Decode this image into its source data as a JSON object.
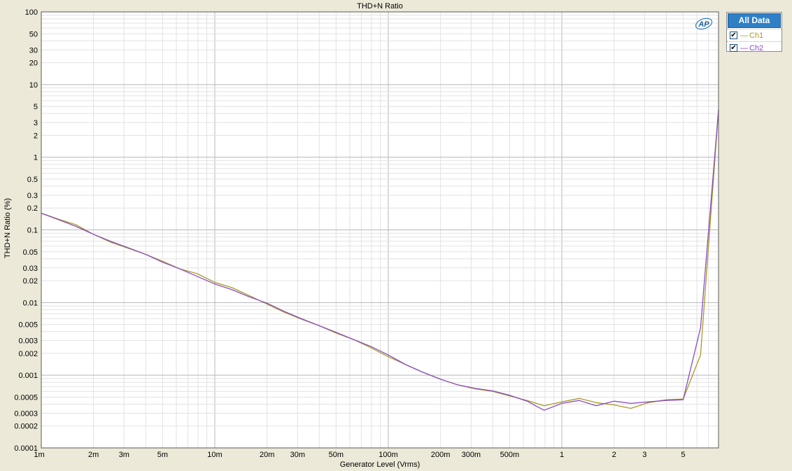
{
  "logo_text": "AP",
  "legend": {
    "header": "All Data",
    "items": [
      {
        "label": "Ch1",
        "color": "#a89a26",
        "checked": true
      },
      {
        "label": "Ch2",
        "color": "#8a4fc2",
        "checked": true
      }
    ]
  },
  "chart_data": {
    "type": "line",
    "title": "THD+N Ratio",
    "xlabel": "Generator Level (Vrms)",
    "ylabel": "THD+N Ratio (%)",
    "x_scale": "log",
    "y_scale": "log",
    "xlim": [
      0.001,
      8
    ],
    "ylim": [
      0.0001,
      100
    ],
    "grid": true,
    "legend_position": "right",
    "x_ticks": [
      {
        "value": 0.001,
        "label": "1m"
      },
      {
        "value": 0.002,
        "label": "2m"
      },
      {
        "value": 0.003,
        "label": "3m"
      },
      {
        "value": 0.005,
        "label": "5m"
      },
      {
        "value": 0.01,
        "label": "10m"
      },
      {
        "value": 0.02,
        "label": "20m"
      },
      {
        "value": 0.03,
        "label": "30m"
      },
      {
        "value": 0.05,
        "label": "50m"
      },
      {
        "value": 0.1,
        "label": "100m"
      },
      {
        "value": 0.2,
        "label": "200m"
      },
      {
        "value": 0.3,
        "label": "300m"
      },
      {
        "value": 0.5,
        "label": "500m"
      },
      {
        "value": 1,
        "label": "1"
      },
      {
        "value": 2,
        "label": "2"
      },
      {
        "value": 3,
        "label": "3"
      },
      {
        "value": 5,
        "label": "5"
      }
    ],
    "y_ticks": [
      {
        "value": 100,
        "label": "100"
      },
      {
        "value": 50,
        "label": "50"
      },
      {
        "value": 30,
        "label": "30"
      },
      {
        "value": 20,
        "label": "20"
      },
      {
        "value": 10,
        "label": "10"
      },
      {
        "value": 5,
        "label": "5"
      },
      {
        "value": 3,
        "label": "3"
      },
      {
        "value": 2,
        "label": "2"
      },
      {
        "value": 1,
        "label": "1"
      },
      {
        "value": 0.5,
        "label": "0.5"
      },
      {
        "value": 0.3,
        "label": "0.3"
      },
      {
        "value": 0.2,
        "label": "0.2"
      },
      {
        "value": 0.1,
        "label": "0.1"
      },
      {
        "value": 0.05,
        "label": "0.05"
      },
      {
        "value": 0.03,
        "label": "0.03"
      },
      {
        "value": 0.02,
        "label": "0.02"
      },
      {
        "value": 0.01,
        "label": "0.01"
      },
      {
        "value": 0.005,
        "label": "0.005"
      },
      {
        "value": 0.003,
        "label": "0.003"
      },
      {
        "value": 0.002,
        "label": "0.002"
      },
      {
        "value": 0.001,
        "label": "0.001"
      },
      {
        "value": 0.0005,
        "label": "0.0005"
      },
      {
        "value": 0.0003,
        "label": "0.0003"
      },
      {
        "value": 0.0002,
        "label": "0.0002"
      },
      {
        "value": 0.0001,
        "label": "0.0001"
      }
    ],
    "series": [
      {
        "name": "Ch1",
        "color": "#a89a26",
        "points": [
          [
            0.001,
            0.17
          ],
          [
            0.00126,
            0.14
          ],
          [
            0.00158,
            0.118
          ],
          [
            0.002,
            0.087
          ],
          [
            0.0025,
            0.068
          ],
          [
            0.00316,
            0.056
          ],
          [
            0.004,
            0.046
          ],
          [
            0.005,
            0.037
          ],
          [
            0.0063,
            0.029
          ],
          [
            0.0079,
            0.025
          ],
          [
            0.01,
            0.019
          ],
          [
            0.0126,
            0.016
          ],
          [
            0.0158,
            0.0125
          ],
          [
            0.02,
            0.0095
          ],
          [
            0.025,
            0.0074
          ],
          [
            0.0316,
            0.0059
          ],
          [
            0.04,
            0.0048
          ],
          [
            0.05,
            0.0038
          ],
          [
            0.063,
            0.0031
          ],
          [
            0.079,
            0.0024
          ],
          [
            0.1,
            0.0018
          ],
          [
            0.126,
            0.0014
          ],
          [
            0.158,
            0.0011
          ],
          [
            0.2,
            0.00088
          ],
          [
            0.25,
            0.00074
          ],
          [
            0.316,
            0.00065
          ],
          [
            0.4,
            0.0006
          ],
          [
            0.5,
            0.00052
          ],
          [
            0.63,
            0.00045
          ],
          [
            0.79,
            0.00038
          ],
          [
            1,
            0.00043
          ],
          [
            1.26,
            0.00048
          ],
          [
            1.58,
            0.00042
          ],
          [
            2,
            0.00039
          ],
          [
            2.5,
            0.00035
          ],
          [
            3.16,
            0.00042
          ],
          [
            4,
            0.00046
          ],
          [
            5,
            0.00047
          ],
          [
            6.3,
            0.0019
          ],
          [
            8,
            4.5
          ]
        ]
      },
      {
        "name": "Ch2",
        "color": "#8a4fc2",
        "points": [
          [
            0.001,
            0.17
          ],
          [
            0.00126,
            0.138
          ],
          [
            0.00158,
            0.112
          ],
          [
            0.002,
            0.087
          ],
          [
            0.0025,
            0.07
          ],
          [
            0.00316,
            0.057
          ],
          [
            0.004,
            0.046
          ],
          [
            0.005,
            0.036
          ],
          [
            0.0063,
            0.029
          ],
          [
            0.0079,
            0.023
          ],
          [
            0.01,
            0.018
          ],
          [
            0.0126,
            0.015
          ],
          [
            0.0158,
            0.012
          ],
          [
            0.02,
            0.0098
          ],
          [
            0.025,
            0.0076
          ],
          [
            0.0316,
            0.006
          ],
          [
            0.04,
            0.0048
          ],
          [
            0.05,
            0.0039
          ],
          [
            0.063,
            0.0031
          ],
          [
            0.079,
            0.0025
          ],
          [
            0.1,
            0.0019
          ],
          [
            0.126,
            0.0014
          ],
          [
            0.158,
            0.0011
          ],
          [
            0.2,
            0.00088
          ],
          [
            0.25,
            0.00074
          ],
          [
            0.316,
            0.00066
          ],
          [
            0.4,
            0.00061
          ],
          [
            0.5,
            0.00053
          ],
          [
            0.63,
            0.00044
          ],
          [
            0.79,
            0.00033
          ],
          [
            1,
            0.00041
          ],
          [
            1.26,
            0.00045
          ],
          [
            1.58,
            0.00038
          ],
          [
            2,
            0.00044
          ],
          [
            2.5,
            0.00041
          ],
          [
            3.16,
            0.00043
          ],
          [
            4,
            0.00045
          ],
          [
            5,
            0.00046
          ],
          [
            6.3,
            0.0045
          ],
          [
            8,
            4.5
          ]
        ]
      }
    ]
  }
}
